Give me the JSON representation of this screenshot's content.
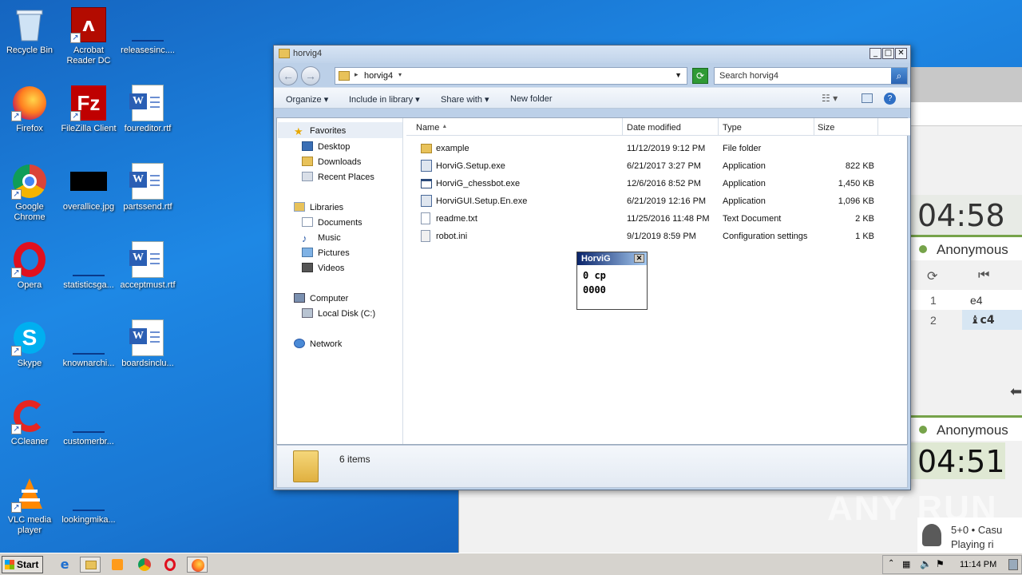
{
  "desktop": {
    "icons": [
      {
        "label": "Recycle Bin"
      },
      {
        "label": "Acrobat Reader DC"
      },
      {
        "label": "releasesinc...."
      },
      {
        "label": "Firefox"
      },
      {
        "label": "FileZilla Client"
      },
      {
        "label": "foureditor.rtf"
      },
      {
        "label": "Google Chrome"
      },
      {
        "label": "overallice.jpg"
      },
      {
        "label": "partssend.rtf"
      },
      {
        "label": "Opera"
      },
      {
        "label": "statisticsga..."
      },
      {
        "label": "acceptmust.rtf"
      },
      {
        "label": "Skype"
      },
      {
        "label": "knownarchi..."
      },
      {
        "label": "boardsinclu..."
      },
      {
        "label": "CCleaner"
      },
      {
        "label": "customerbr..."
      },
      {
        "label": "VLC media player"
      },
      {
        "label": "lookingmika..."
      }
    ]
  },
  "explorer": {
    "title": "horvig4",
    "address": "horvig4",
    "search_placeholder": "Search horvig4",
    "toolbar": {
      "organize": "Organize",
      "include_in_library": "Include in library",
      "share_with": "Share with",
      "new_folder": "New folder"
    },
    "nav": {
      "favorites": "Favorites",
      "desktop": "Desktop",
      "downloads": "Downloads",
      "recent_places": "Recent Places",
      "libraries": "Libraries",
      "documents": "Documents",
      "music": "Music",
      "pictures": "Pictures",
      "videos": "Videos",
      "computer": "Computer",
      "local_disk": "Local Disk (C:)",
      "network": "Network"
    },
    "columns": {
      "name": "Name",
      "date_modified": "Date modified",
      "type": "Type",
      "size": "Size"
    },
    "files": [
      {
        "name": "example",
        "date": "11/12/2019 9:12 PM",
        "type": "File folder",
        "size": ""
      },
      {
        "name": "HorviG.Setup.exe",
        "date": "6/21/2017 3:27 PM",
        "type": "Application",
        "size": "822 KB"
      },
      {
        "name": "HorviG_chessbot.exe",
        "date": "12/6/2016 8:52 PM",
        "type": "Application",
        "size": "1,450 KB"
      },
      {
        "name": "HorviGUI.Setup.En.exe",
        "date": "6/21/2019 12:16 PM",
        "type": "Application",
        "size": "1,096 KB"
      },
      {
        "name": "readme.txt",
        "date": "11/25/2016 11:48 PM",
        "type": "Text Document",
        "size": "2 KB"
      },
      {
        "name": "robot.ini",
        "date": "9/1/2019 8:59 PM",
        "type": "Configuration settings",
        "size": "1 KB"
      }
    ],
    "status": "6 items"
  },
  "horvig_popup": {
    "title": "HorviG",
    "line1": "0 cp",
    "line2": "0000"
  },
  "chess": {
    "clock_top": "04:58",
    "player_top": "Anonymous",
    "moves": [
      {
        "num": "1",
        "move": "e4"
      },
      {
        "num": "2",
        "move": "♝c4"
      }
    ],
    "player_bottom": "Anonymous",
    "clock_bottom": "04:51",
    "game_info": "5+0 • Casu",
    "game_info2": "Playing ri"
  },
  "watermark": "ANY RUN",
  "taskbar": {
    "start": "Start",
    "clock": "11:14 PM"
  }
}
